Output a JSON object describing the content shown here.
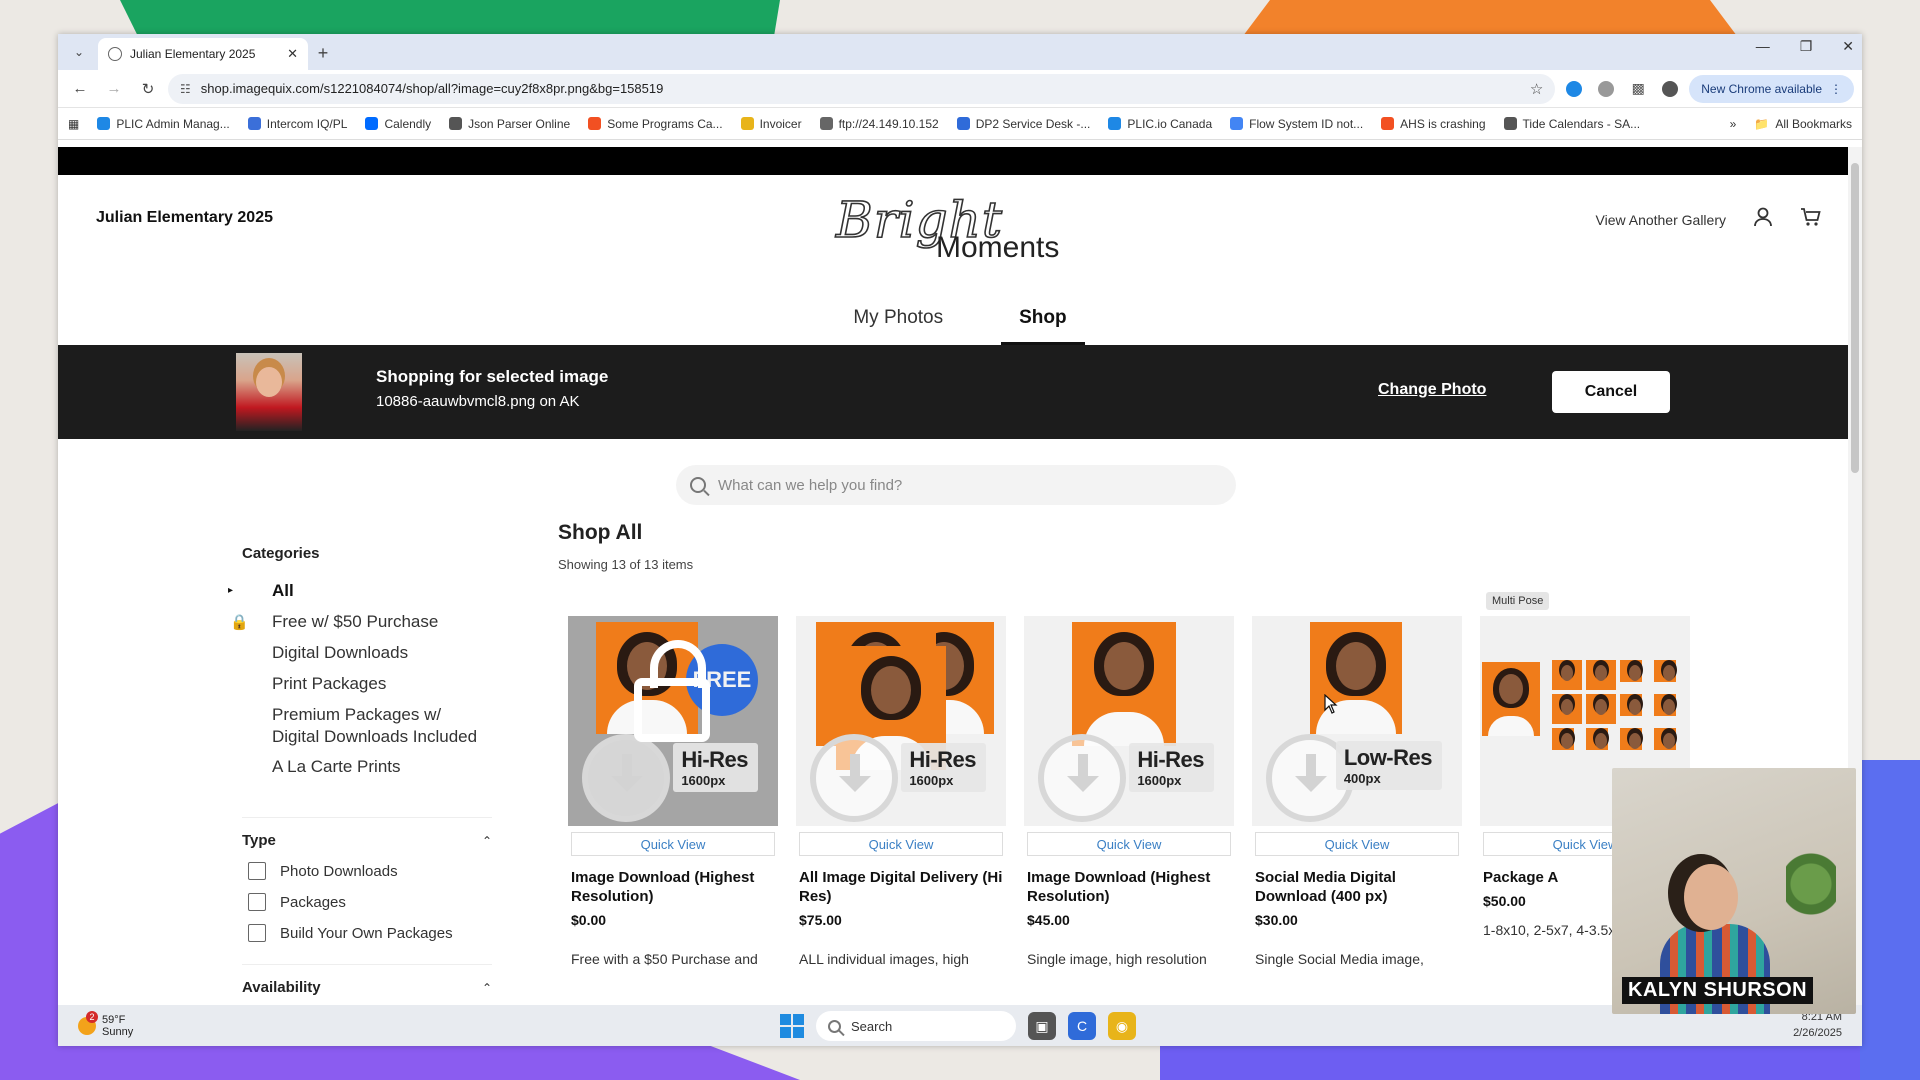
{
  "browser": {
    "tab_title": "Julian Elementary 2025",
    "url": "shop.imagequix.com/s1221084074/shop/all?image=cuy2f8x8pr.png&bg=158519",
    "new_chrome_label": "New Chrome available",
    "bookmarks": [
      {
        "label": "PLIC Admin Manag...",
        "color": "#1e88e5"
      },
      {
        "label": "Intercom IQ/PL",
        "color": "#3b6fd9"
      },
      {
        "label": "Calendly",
        "color": "#006bff"
      },
      {
        "label": "Json Parser Online",
        "color": "#555555"
      },
      {
        "label": "Some Programs Ca...",
        "color": "#f25022"
      },
      {
        "label": "Invoicer",
        "color": "#e8b41a"
      },
      {
        "label": "ftp://24.149.10.152",
        "color": "#666666"
      },
      {
        "label": "DP2 Service Desk -...",
        "color": "#2f6bd9"
      },
      {
        "label": "PLIC.io Canada",
        "color": "#1e88e5"
      },
      {
        "label": "Flow System ID not...",
        "color": "#4285f4"
      },
      {
        "label": "AHS is crashing",
        "color": "#f25022"
      },
      {
        "label": "Tide Calendars - SA...",
        "color": "#555555"
      }
    ],
    "all_bookmarks_label": "All Bookmarks"
  },
  "header": {
    "gallery_name": "Julian Elementary 2025",
    "logo_script": "Bright",
    "logo_sub": "Moments",
    "view_another_gallery": "View Another Gallery"
  },
  "nav": {
    "tabs": [
      {
        "label": "My Photos",
        "active": false
      },
      {
        "label": "Shop",
        "active": true
      }
    ]
  },
  "banner": {
    "title": "Shopping for selected image",
    "subtitle": "10886-aauwbvmcl8.png on AK",
    "change_photo": "Change Photo",
    "cancel": "Cancel"
  },
  "search": {
    "placeholder": "What can we help you find?"
  },
  "sidebar": {
    "categories_heading": "Categories",
    "categories": [
      {
        "label": "All",
        "selected": true
      },
      {
        "label": "Free w/ $50 Purchase",
        "locked": true
      },
      {
        "label": "Digital Downloads"
      },
      {
        "label": "Print Packages"
      },
      {
        "label": "Premium Packages w/ Digital Downloads Included"
      },
      {
        "label": "A La Carte Prints"
      }
    ],
    "type_heading": "Type",
    "type_options": [
      "Photo Downloads",
      "Packages",
      "Build Your Own Packages"
    ],
    "availability_heading": "Availability"
  },
  "content": {
    "title": "Shop All",
    "showing": "Showing 13 of 13 items",
    "quick_view_label": "Quick View",
    "products": [
      {
        "name": "Image Download (Highest Resolution)",
        "price": "$0.00",
        "desc": "Free with a $50 Purchase and",
        "res_big": "Hi-Res",
        "res_small": "1600px",
        "free_badge": "FREE"
      },
      {
        "name": "All Image Digital Delivery (Hi Res)",
        "price": "$75.00",
        "desc": "ALL individual images, high",
        "res_big": "Hi-Res",
        "res_small": "1600px"
      },
      {
        "name": "Image Download (Highest Resolution)",
        "price": "$45.00",
        "desc": "Single image, high resolution",
        "res_big": "Hi-Res",
        "res_small": "1600px"
      },
      {
        "name": "Social Media Digital Download (400 px)",
        "price": "$30.00",
        "desc": "Single Social Media image,",
        "res_big": "Low-Res",
        "res_small": "400px"
      },
      {
        "name": "Package A",
        "price": "$50.00",
        "desc": "1-8x10, 2-5x7, 4-3.5x5",
        "badge": "Multi Pose"
      }
    ]
  },
  "webcam": {
    "name": "KALYN SHURSON"
  },
  "taskbar": {
    "temp": "59°F",
    "condition": "Sunny",
    "notifications": "2",
    "search_label": "Search",
    "time": "8:21 AM",
    "date": "2/26/2025"
  }
}
